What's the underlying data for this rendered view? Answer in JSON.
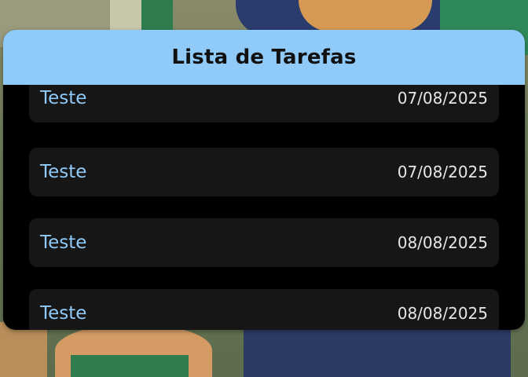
{
  "header": {
    "title": "Lista de Tarefas"
  },
  "tasks": [
    {
      "title": "Teste",
      "date": "07/08/2025"
    },
    {
      "title": "Teste",
      "date": "07/08/2025"
    },
    {
      "title": "Teste",
      "date": "08/08/2025"
    },
    {
      "title": "Teste",
      "date": "08/08/2025"
    }
  ],
  "colors": {
    "header_bg": "#90caf9",
    "task_title": "#90caf9",
    "card_bg": "#161616",
    "list_bg": "#000000"
  }
}
